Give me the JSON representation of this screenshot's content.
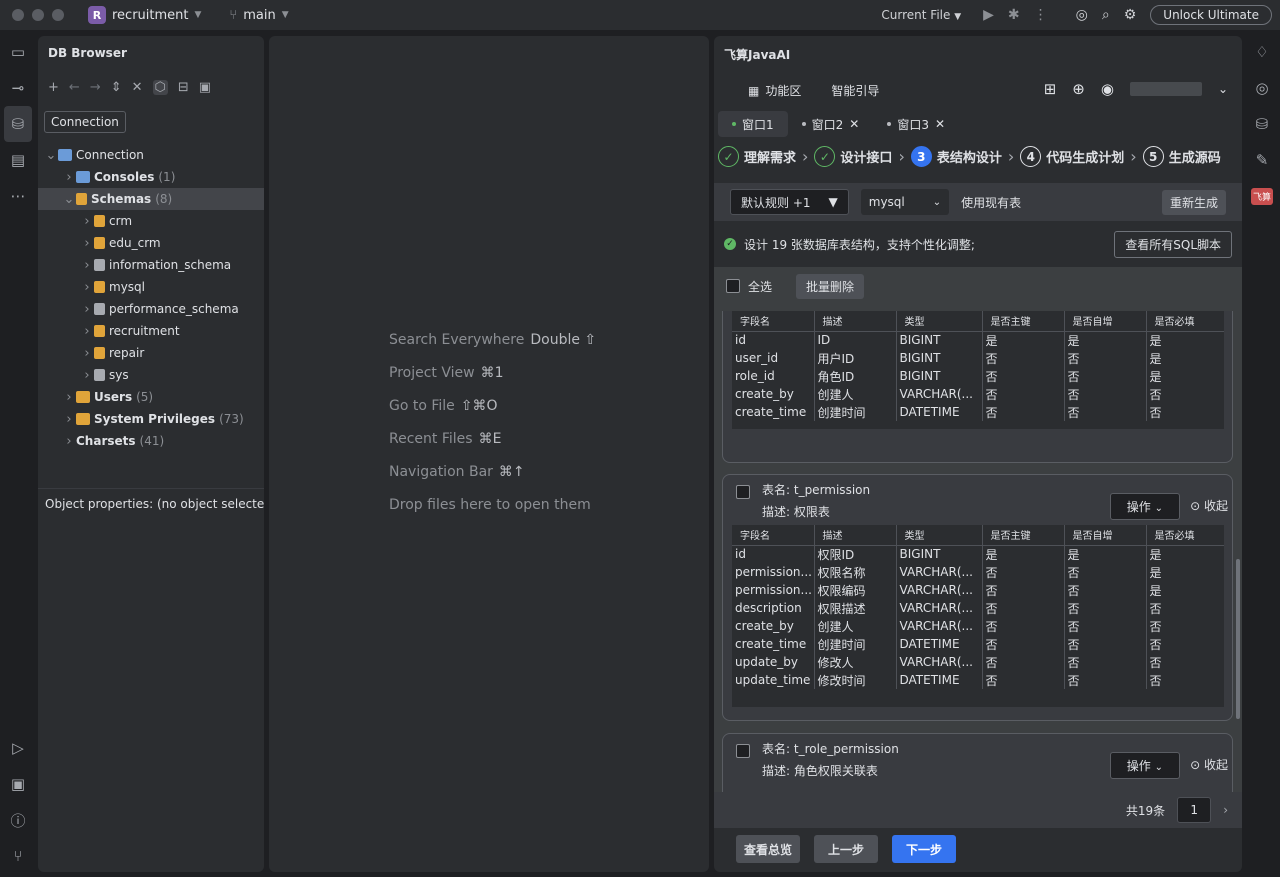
{
  "titlebar": {
    "project_badge": "R",
    "project": "recruitment",
    "branch": "main",
    "current_file": "Current File",
    "unlock": "Unlock Ultimate"
  },
  "db": {
    "title": "DB Browser",
    "tooltip": "Connection",
    "tree": [
      {
        "label": "Connection",
        "count": "",
        "level": 0,
        "bold": false,
        "expanded": true,
        "icon": "db-icon"
      },
      {
        "label": "Consoles",
        "count": "(1)",
        "level": 1,
        "bold": true,
        "expanded": false,
        "icon": "console-icon"
      },
      {
        "label": "Schemas",
        "count": "(8)",
        "level": 1,
        "bold": true,
        "expanded": true,
        "icon": "schema-icon",
        "selected": true
      },
      {
        "label": "crm",
        "count": "",
        "level": 2,
        "bold": false,
        "expanded": false,
        "icon": "schema-icon"
      },
      {
        "label": "edu_crm",
        "count": "",
        "level": 2,
        "bold": false,
        "expanded": false,
        "icon": "schema-icon"
      },
      {
        "label": "information_schema",
        "count": "",
        "level": 2,
        "bold": false,
        "expanded": false,
        "icon": "schema-gray-icon"
      },
      {
        "label": "mysql",
        "count": "",
        "level": 2,
        "bold": false,
        "expanded": false,
        "icon": "schema-icon"
      },
      {
        "label": "performance_schema",
        "count": "",
        "level": 2,
        "bold": false,
        "expanded": false,
        "icon": "schema-gray-icon"
      },
      {
        "label": "recruitment",
        "count": "",
        "level": 2,
        "bold": false,
        "expanded": false,
        "icon": "schema-icon"
      },
      {
        "label": "repair",
        "count": "",
        "level": 2,
        "bold": false,
        "expanded": false,
        "icon": "schema-icon"
      },
      {
        "label": "sys",
        "count": "",
        "level": 2,
        "bold": false,
        "expanded": false,
        "icon": "schema-gray-icon"
      },
      {
        "label": "Users",
        "count": "(5)",
        "level": 1,
        "bold": true,
        "expanded": false,
        "icon": "users-icon"
      },
      {
        "label": "System Privileges",
        "count": "(73)",
        "level": 1,
        "bold": true,
        "expanded": false,
        "icon": "privileges-icon"
      },
      {
        "label": "Charsets",
        "count": "(41)",
        "level": 1,
        "bold": true,
        "expanded": false,
        "icon": ""
      }
    ],
    "object_props": "Object properties:   (no object selected"
  },
  "editor": {
    "hints": [
      {
        "text": "Search Everywhere",
        "key": "Double ⇧"
      },
      {
        "text": "Project View",
        "key": "⌘1"
      },
      {
        "text": "Go to File",
        "key": "⇧⌘O"
      },
      {
        "text": "Recent Files",
        "key": "⌘E"
      },
      {
        "text": "Navigation Bar",
        "key": "⌘↑"
      },
      {
        "text": "Drop files here to open them",
        "key": ""
      }
    ]
  },
  "ai": {
    "title": "飞算JavaAI",
    "nav_func": "功能区",
    "nav_guide": "智能引导",
    "tabs": [
      "窗口1",
      "窗口2",
      "窗口3"
    ],
    "steps": [
      {
        "num": "✓",
        "label": "理解需求",
        "state": "done"
      },
      {
        "num": "✓",
        "label": "设计接口",
        "state": "done"
      },
      {
        "num": "3",
        "label": "表结构设计",
        "state": "current"
      },
      {
        "num": "4",
        "label": "代码生成计划",
        "state": "todo"
      },
      {
        "num": "5",
        "label": "生成源码",
        "state": "todo"
      }
    ],
    "rule": "默认规则 +1",
    "db_type": "mysql",
    "use_existing": "使用现有表",
    "regen": "重新生成",
    "info": "设计 19 张数据库表结构，支持个性化调整;",
    "view_sql": "查看所有SQL脚本",
    "select_all": "全选",
    "batch_delete": "批量删除",
    "op": "操作",
    "collapse": "收起",
    "table_name_label": "表名: ",
    "desc_label": "描述: ",
    "columns": [
      "字段名",
      "描述",
      "类型",
      "是否主键",
      "是否自增",
      "是否必填"
    ],
    "partial_table": {
      "rows": [
        [
          "id",
          "ID",
          "BIGINT",
          "是",
          "是",
          "是"
        ],
        [
          "user_id",
          "用户ID",
          "BIGINT",
          "否",
          "否",
          "是"
        ],
        [
          "role_id",
          "角色ID",
          "BIGINT",
          "否",
          "否",
          "是"
        ],
        [
          "create_by",
          "创建人",
          "VARCHAR(...",
          "否",
          "否",
          "否"
        ],
        [
          "create_time",
          "创建时间",
          "DATETIME",
          "否",
          "否",
          "否"
        ]
      ]
    },
    "table2": {
      "name": "t_permission",
      "desc": "权限表",
      "rows": [
        [
          "id",
          "权限ID",
          "BIGINT",
          "是",
          "是",
          "是"
        ],
        [
          "permission...",
          "权限名称",
          "VARCHAR(...",
          "否",
          "否",
          "是"
        ],
        [
          "permission...",
          "权限编码",
          "VARCHAR(...",
          "否",
          "否",
          "是"
        ],
        [
          "description",
          "权限描述",
          "VARCHAR(...",
          "否",
          "否",
          "否"
        ],
        [
          "create_by",
          "创建人",
          "VARCHAR(...",
          "否",
          "否",
          "否"
        ],
        [
          "create_time",
          "创建时间",
          "DATETIME",
          "否",
          "否",
          "否"
        ],
        [
          "update_by",
          "修改人",
          "VARCHAR(...",
          "否",
          "否",
          "否"
        ],
        [
          "update_time",
          "修改时间",
          "DATETIME",
          "否",
          "否",
          "否"
        ]
      ]
    },
    "table3": {
      "name": "t_role_permission",
      "desc": "角色权限关联表"
    },
    "total": "共19条",
    "page": "1",
    "btn_overview": "查看总览",
    "btn_prev": "上一步",
    "btn_next": "下一步"
  }
}
